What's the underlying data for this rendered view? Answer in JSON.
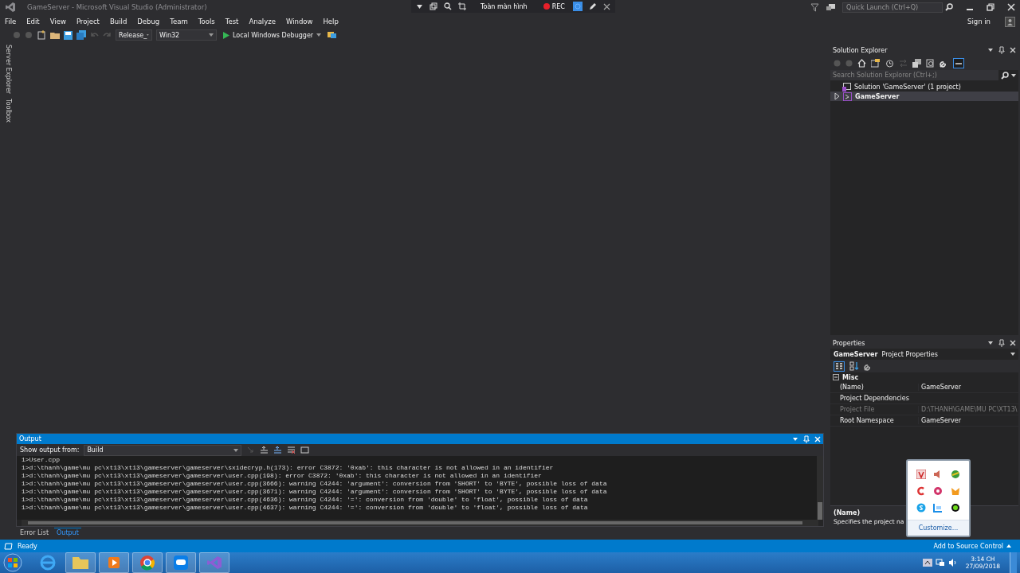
{
  "window": {
    "title": "GameServer - Microsoft Visual Studio  (Administrator)"
  },
  "recorder": {
    "mode": "Toàn màn hình",
    "rec": "REC"
  },
  "quick_launch": {
    "placeholder": "Quick Launch (Ctrl+Q)"
  },
  "menu": [
    "File",
    "Edit",
    "View",
    "Project",
    "Build",
    "Debug",
    "Team",
    "Tools",
    "Test",
    "Analyze",
    "Window",
    "Help"
  ],
  "sign_in": "Sign in",
  "toolbar": {
    "configuration": "Release_",
    "platform": "Win32",
    "debugger": "Local Windows Debugger"
  },
  "side_tabs": [
    "Server Explorer",
    "Toolbox"
  ],
  "solution_explorer": {
    "title": "Solution Explorer",
    "search": {
      "placeholder": "Search Solution Explorer (Ctrl+;)"
    },
    "tree": [
      {
        "label": "Solution 'GameServer' (1 project)",
        "selected": false,
        "children": [
          {
            "label": "GameServer",
            "expanded": false,
            "selected": true
          }
        ]
      }
    ]
  },
  "properties": {
    "title": "Properties",
    "object": "GameServer",
    "object_type": "Project Properties",
    "categories": [
      {
        "name": "Misc",
        "expanded": true,
        "rows": [
          {
            "name": "(Name)",
            "value": "GameServer",
            "disabled": false
          },
          {
            "name": "Project Dependencies",
            "disabled": false
          },
          {
            "name": "Project File",
            "value": "D:\\THANH\\GAME\\MU PC\\XT13\\",
            "disabled": true
          },
          {
            "name": "Root Namespace",
            "value": "GameServer",
            "disabled": false
          }
        ]
      }
    ],
    "description": {
      "title": "(Name)",
      "text": "Specifies the project na"
    }
  },
  "output": {
    "title": "Output",
    "source_label": "Show output from:",
    "source": "Build",
    "lines": [
      "1>User.cpp",
      "1>d:\\thanh\\game\\mu pc\\xt13\\xt13\\gameserver\\gameserver\\sxidecryp.h(173): error C3872: '0xab': this character is not allowed in an identifier",
      "1>d:\\thanh\\game\\mu pc\\xt13\\xt13\\gameserver\\gameserver\\user.cpp(198): error C3872: '0xab': this character is not allowed in an identifier",
      "1>d:\\thanh\\game\\mu pc\\xt13\\xt13\\gameserver\\gameserver\\user.cpp(3666): warning C4244: 'argument': conversion from 'SHORT' to 'BYTE', possible loss of data",
      "1>d:\\thanh\\game\\mu pc\\xt13\\xt13\\gameserver\\gameserver\\user.cpp(3671): warning C4244: 'argument': conversion from 'SHORT' to 'BYTE', possible loss of data",
      "1>d:\\thanh\\game\\mu pc\\xt13\\xt13\\gameserver\\gameserver\\user.cpp(4636): warning C4244: '=': conversion from 'double' to 'float', possible loss of data",
      "1>d:\\thanh\\game\\mu pc\\xt13\\xt13\\gameserver\\gameserver\\user.cpp(4637): warning C4244: '=': conversion from 'double' to 'float', possible loss of data"
    ]
  },
  "bottom_tabs": [
    {
      "label": "Error List",
      "selected": false
    },
    {
      "label": "Output",
      "selected": true
    }
  ],
  "status_bar": {
    "text": "Ready",
    "source_control": "Add to Source Control"
  },
  "tray_popup": {
    "action": "Customize..."
  },
  "taskbar": {
    "clock": {
      "time": "3:14 CH",
      "date": "27/09/2018"
    }
  }
}
